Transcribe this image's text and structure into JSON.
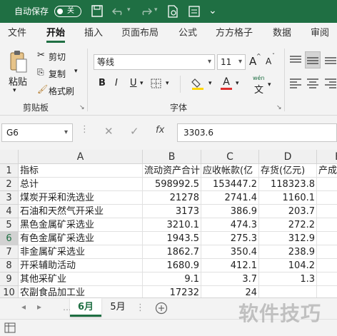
{
  "titlebar": {
    "autosave_label": "自动保存",
    "autosave_state": "关"
  },
  "tabs": [
    "文件",
    "开始",
    "插入",
    "页面布局",
    "公式",
    "方方格子",
    "数据",
    "审阅"
  ],
  "ribbon": {
    "paste_label": "粘贴",
    "cut_label": "剪切",
    "copy_label": "复制",
    "format_painter_label": "格式刷",
    "clipboard_group": "剪贴板",
    "font_name": "等线",
    "font_size": "11",
    "grow_font": "A",
    "shrink_font": "A",
    "bold": "B",
    "italic": "I",
    "underline": "U",
    "wen_label": "wén",
    "font_group": "字体"
  },
  "formula_bar": {
    "name_box": "G6",
    "fx": "fx",
    "value": "3303.6"
  },
  "sheet": {
    "columns": [
      "A",
      "B",
      "C",
      "D",
      "E"
    ],
    "selected_row": 6,
    "rows": [
      {
        "n": "1",
        "a": "指标",
        "b": "流动资产合计",
        "c": "应收帐款(亿",
        "d": "存货(亿元)",
        "e": "产成"
      },
      {
        "n": "2",
        "a": "总计",
        "b": "598992.5",
        "c": "153447.2",
        "d": "118323.8",
        "e": ""
      },
      {
        "n": "3",
        "a": "煤炭开采和洗选业",
        "b": "21278",
        "c": "2741.4",
        "d": "1160.1",
        "e": ""
      },
      {
        "n": "4",
        "a": "石油和天然气开采业",
        "b": "3173",
        "c": "386.9",
        "d": "203.7",
        "e": ""
      },
      {
        "n": "5",
        "a": "黑色金属矿采选业",
        "b": "3210.1",
        "c": "474.3",
        "d": "272.2",
        "e": ""
      },
      {
        "n": "6",
        "a": "有色金属矿采选业",
        "b": "1943.5",
        "c": "275.3",
        "d": "312.9",
        "e": ""
      },
      {
        "n": "7",
        "a": "非金属矿采选业",
        "b": "1862.7",
        "c": "350.4",
        "d": "238.9",
        "e": ""
      },
      {
        "n": "8",
        "a": "开采辅助活动",
        "b": "1680.9",
        "c": "412.1",
        "d": "104.2",
        "e": ""
      },
      {
        "n": "9",
        "a": "其他采矿业",
        "b": "9.1",
        "c": "3.7",
        "d": "1.3",
        "e": ""
      },
      {
        "n": "10",
        "a": "农副食品加工业",
        "b": "17232",
        "c": "24",
        "d": "",
        "e": ""
      }
    ]
  },
  "sheet_tabs": [
    "6月",
    "5月"
  ],
  "active_sheet": "6月",
  "watermark": "软件技巧",
  "colors": {
    "accent": "#1f6f43"
  }
}
